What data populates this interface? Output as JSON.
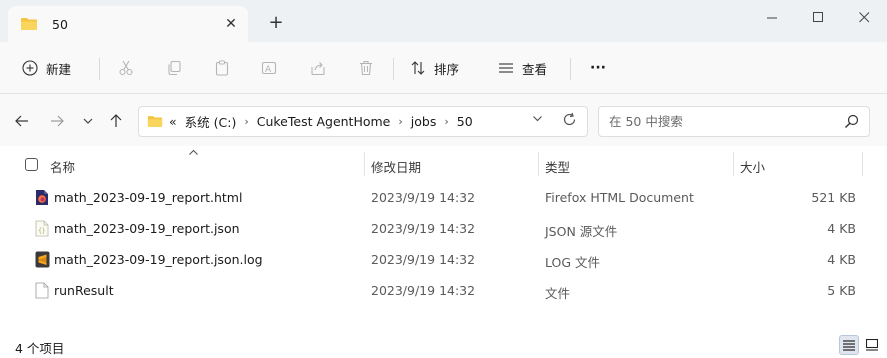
{
  "window": {
    "tab_title": "50",
    "new_tab": "+"
  },
  "toolbar": {
    "new_label": "新建",
    "sort_label": "排序",
    "view_label": "查看",
    "more_label": "···"
  },
  "address": {
    "overflow": "«",
    "crumbs": [
      "系统 (C:)",
      "CukeTest AgentHome",
      "jobs",
      "50"
    ]
  },
  "search": {
    "placeholder": "在 50 中搜索"
  },
  "columns": {
    "name": "名称",
    "modified": "修改日期",
    "type": "类型",
    "size": "大小"
  },
  "files": [
    {
      "name": "math_2023-09-19_report.html",
      "modified": "2023/9/19 14:32",
      "type": "Firefox HTML Document",
      "size": "521 KB",
      "icon": "firefox-html-file-icon"
    },
    {
      "name": "math_2023-09-19_report.json",
      "modified": "2023/9/19 14:32",
      "type": "JSON 源文件",
      "size": "4 KB",
      "icon": "json-file-icon"
    },
    {
      "name": "math_2023-09-19_report.json.log",
      "modified": "2023/9/19 14:32",
      "type": "LOG 文件",
      "size": "4 KB",
      "icon": "sublime-log-file-icon"
    },
    {
      "name": "runResult",
      "modified": "2023/9/19 14:32",
      "type": "文件",
      "size": "5 KB",
      "icon": "generic-file-icon"
    }
  ],
  "status": {
    "item_count": "4 个项目"
  },
  "colors": {
    "folder": "#f4c542",
    "accent": "#0067c0"
  }
}
